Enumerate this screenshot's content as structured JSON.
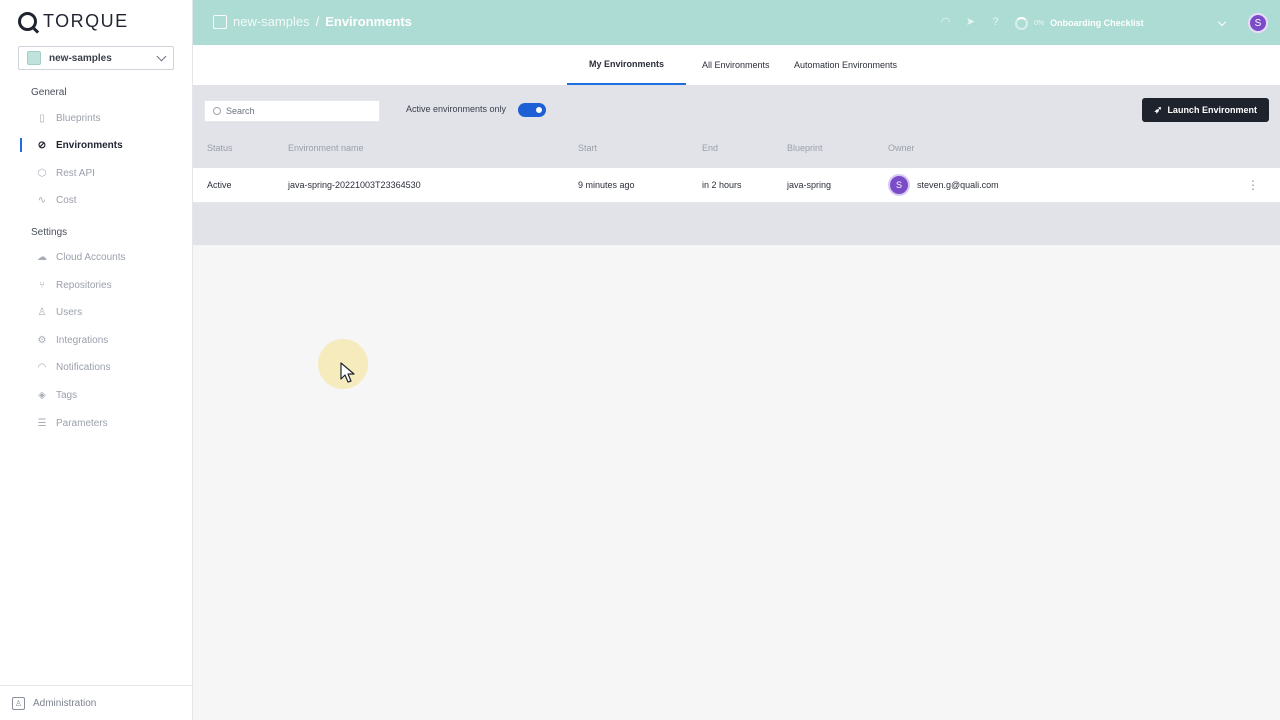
{
  "brand": {
    "name": "TORQUE"
  },
  "space_selector": {
    "value": "new-samples"
  },
  "sidebar": {
    "general_title": "General",
    "general_items": [
      {
        "label": "Blueprints",
        "icon": "map-icon"
      },
      {
        "label": "Environments",
        "icon": "environments-icon",
        "active": true
      },
      {
        "label": "Rest API",
        "icon": "cube-icon"
      },
      {
        "label": "Cost",
        "icon": "activity-icon"
      }
    ],
    "settings_title": "Settings",
    "settings_items": [
      {
        "label": "Cloud Accounts",
        "icon": "cloud-icon"
      },
      {
        "label": "Repositories",
        "icon": "git-branch-icon"
      },
      {
        "label": "Users",
        "icon": "users-icon"
      },
      {
        "label": "Integrations",
        "icon": "gear-icon"
      },
      {
        "label": "Notifications",
        "icon": "bell-icon"
      },
      {
        "label": "Tags",
        "icon": "tag-icon"
      },
      {
        "label": "Parameters",
        "icon": "sliders-icon"
      }
    ],
    "admin_label": "Administration"
  },
  "header": {
    "space": "new-samples",
    "separator": "/",
    "page": "Environments",
    "onboarding": {
      "percent": "0%",
      "label": "Onboarding Checklist"
    },
    "avatar_initial": "S"
  },
  "tabs": [
    {
      "label": "My Environments",
      "active": true
    },
    {
      "label": "All Environments"
    },
    {
      "label": "Automation Environments"
    }
  ],
  "toolbar": {
    "search_placeholder": "Search",
    "toggle_label": "Active environments only",
    "toggle_on": true,
    "launch_label": "Launch Environment"
  },
  "table": {
    "columns": [
      "Status",
      "Environment name",
      "Start",
      "End",
      "Blueprint",
      "Owner"
    ],
    "rows": [
      {
        "status": "Active",
        "name": "java-spring-20221003T23364530",
        "start": "9 minutes ago",
        "end": "in 2 hours",
        "blueprint": "java-spring",
        "owner_initial": "S",
        "owner": "steven.g@quali.com"
      }
    ]
  },
  "colors": {
    "header_bg": "#acdcd3",
    "accent": "#1f6fe0",
    "button_dark": "#1e232d",
    "avatar": "#7a4cc8"
  }
}
